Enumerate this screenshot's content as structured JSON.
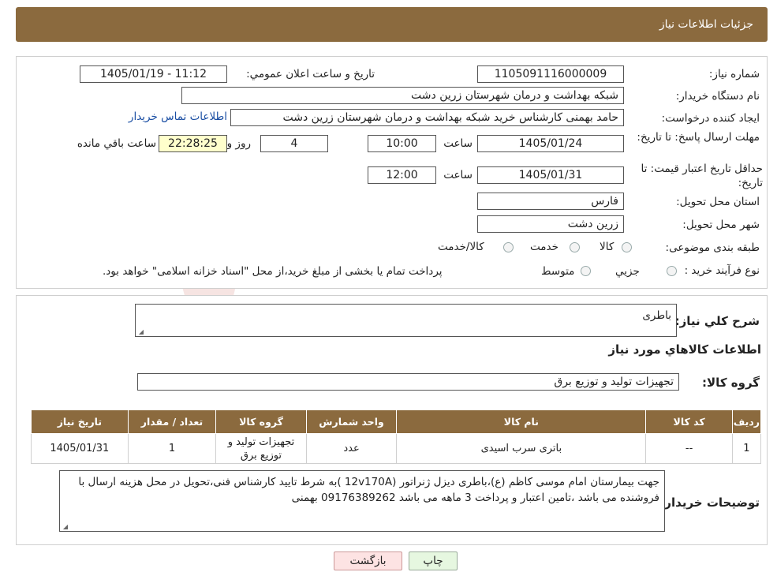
{
  "header": {
    "title": "جزئیات اطلاعات نیاز"
  },
  "form": {
    "need_number_label": "شماره نیاز:",
    "need_number": "1105091116000009",
    "announce_label": "تاریخ و ساعت اعلان عمومي:",
    "announce_value": "1405/01/19 - 11:12",
    "buyer_label": "نام دستگاه خريدار:",
    "buyer_value": "شبکه بهداشت و درمان شهرستان زرین دشت",
    "creator_label": "ايجاد کننده درخواست:",
    "creator_value": "حامد بهمنی کارشناس خرید شبکه بهداشت و درمان شهرستان زرین دشت",
    "contact_link": "اطلاعات تماس خريدار",
    "deadline_label": "مهلت ارسال پاسخ: تا تاريخ:",
    "deadline_date": "1405/01/24",
    "time_label": "ساعت",
    "deadline_time": "10:00",
    "days_value": "4",
    "days_label": "روز و",
    "remaining_time": "22:28:25",
    "remaining_label": "ساعت باقي مانده",
    "validity_label": "حداقل تاريخ اعتبار قيمت: تا تاريخ:",
    "validity_date": "1405/01/31",
    "validity_time": "12:00",
    "province_label": "استان محل تحويل:",
    "province_value": "فارس",
    "city_label": "شهر محل تحويل:",
    "city_value": "زرین دشت",
    "category_label": "طبقه بندی موضوعی:",
    "category_options": [
      "کالا",
      "خدمت",
      "کالا/خدمت"
    ],
    "process_label": "نوع فرآيند خريد :",
    "process_options": [
      "جزيي",
      "متوسط"
    ],
    "process_note": "پرداخت تمام يا بخشی از مبلغ خريد،از محل \"اسناد خزانه اسلامی\" خواهد بود."
  },
  "details": {
    "summary_label": "شرح كلي نياز:",
    "summary_value": "باطری",
    "goods_info_title": "اطلاعات كالاهاي مورد نياز",
    "goods_group_label": "گروه کالا:",
    "goods_group_value": "تجهیزات تولید و توزیع برق",
    "table": {
      "headers": [
        "رديف",
        "کد کالا",
        "نام کالا",
        "واحد شمارش",
        "گروه کالا",
        "تعداد / مقدار",
        "تاريخ نياز"
      ],
      "rows": [
        [
          "1",
          "--",
          "باتری سرب اسیدی",
          "عدد",
          "تجهیزات تولید و توزیع برق",
          "1",
          "1405/01/31"
        ]
      ]
    },
    "buyer_notes_label": "توضيحات خريدار:",
    "buyer_notes_value": "جهت بیمارستان امام موسی کاظم (ع)،باطری دیزل ژنراتور (12v170A )به شرط تایید کارشناس فنی،تحویل در محل هزینه ارسال با فروشنده می باشد ،تامین اعتبار و پرداخت 3 ماهه می باشد 09176389262 بهمنی"
  },
  "buttons": {
    "print": "چاپ",
    "back": "بازگشت"
  },
  "colors": {
    "header": "#8b6a3e",
    "remaining_bg": "#ffffcc",
    "back_button": "#fde3e3",
    "print_button": "#e6f7e0"
  },
  "watermark": {
    "text": "AriaTender.neT"
  }
}
